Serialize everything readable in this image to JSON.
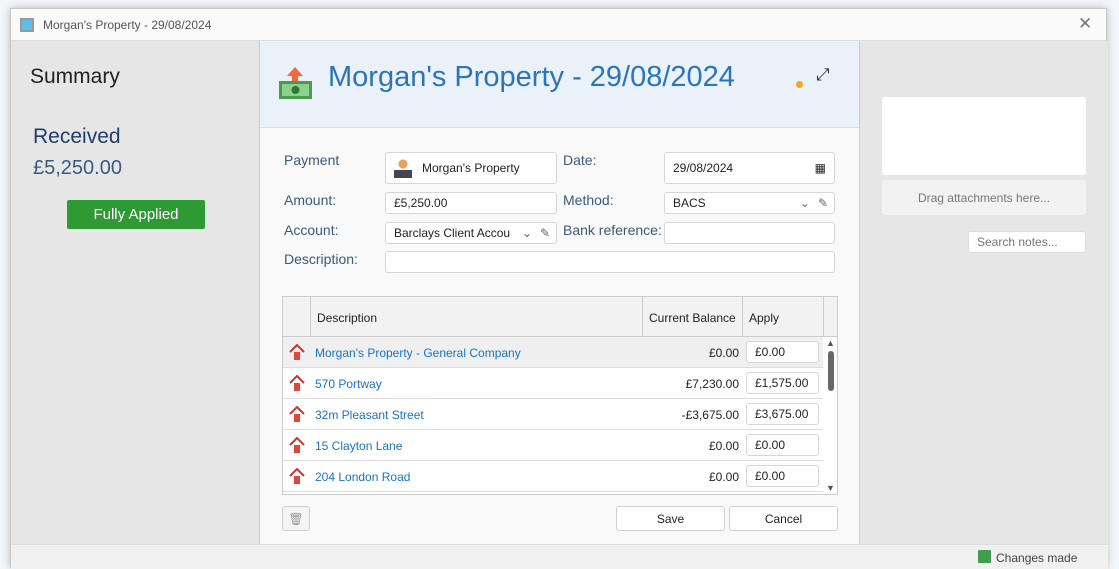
{
  "window": {
    "title": "Morgan's Property - 29/08/2024",
    "close_icon": "close-icon"
  },
  "summary": {
    "heading": "Summary",
    "received_label": "Received",
    "received_amount": "£5,250.00",
    "status": "Fully Applied",
    "status_color": "#2e9a33"
  },
  "header": {
    "title": "Morgan's Property - 29/08/2024",
    "icon": "money-out-icon",
    "indicator_color": "#f5a623"
  },
  "form": {
    "payment_label": "Payment",
    "payment_value": "Morgan's Property",
    "amount_label": "Amount:",
    "amount_value": "£5,250.00",
    "account_label": "Account:",
    "account_value": "Barclays Client Accou",
    "description_label": "Description:",
    "description_value": "",
    "date_label": "Date:",
    "date_value": "29/08/2024",
    "method_label": "Method:",
    "method_value": "BACS",
    "bank_ref_label": "Bank reference:",
    "bank_ref_value": ""
  },
  "table": {
    "headers": [
      "Description",
      "Current Balance",
      "Apply"
    ],
    "rows": [
      {
        "description": "Morgan's Property - General Company",
        "balance": "£0.00",
        "apply": "£0.00"
      },
      {
        "description": "570 Portway",
        "balance": "£7,230.00",
        "apply": "£1,575.00"
      },
      {
        "description": "32m Pleasant Street",
        "balance": "-£3,675.00",
        "apply": "£3,675.00"
      },
      {
        "description": "15 Clayton Lane",
        "balance": "£0.00",
        "apply": "£0.00"
      },
      {
        "description": "204 London Road",
        "balance": "£0.00",
        "apply": "£0.00"
      }
    ]
  },
  "actions": {
    "save": "Save",
    "cancel": "Cancel"
  },
  "attachments": {
    "drop_text": "Drag attachments here...",
    "search_placeholder": "Search notes..."
  },
  "status_bar": {
    "text": "Changes made"
  }
}
